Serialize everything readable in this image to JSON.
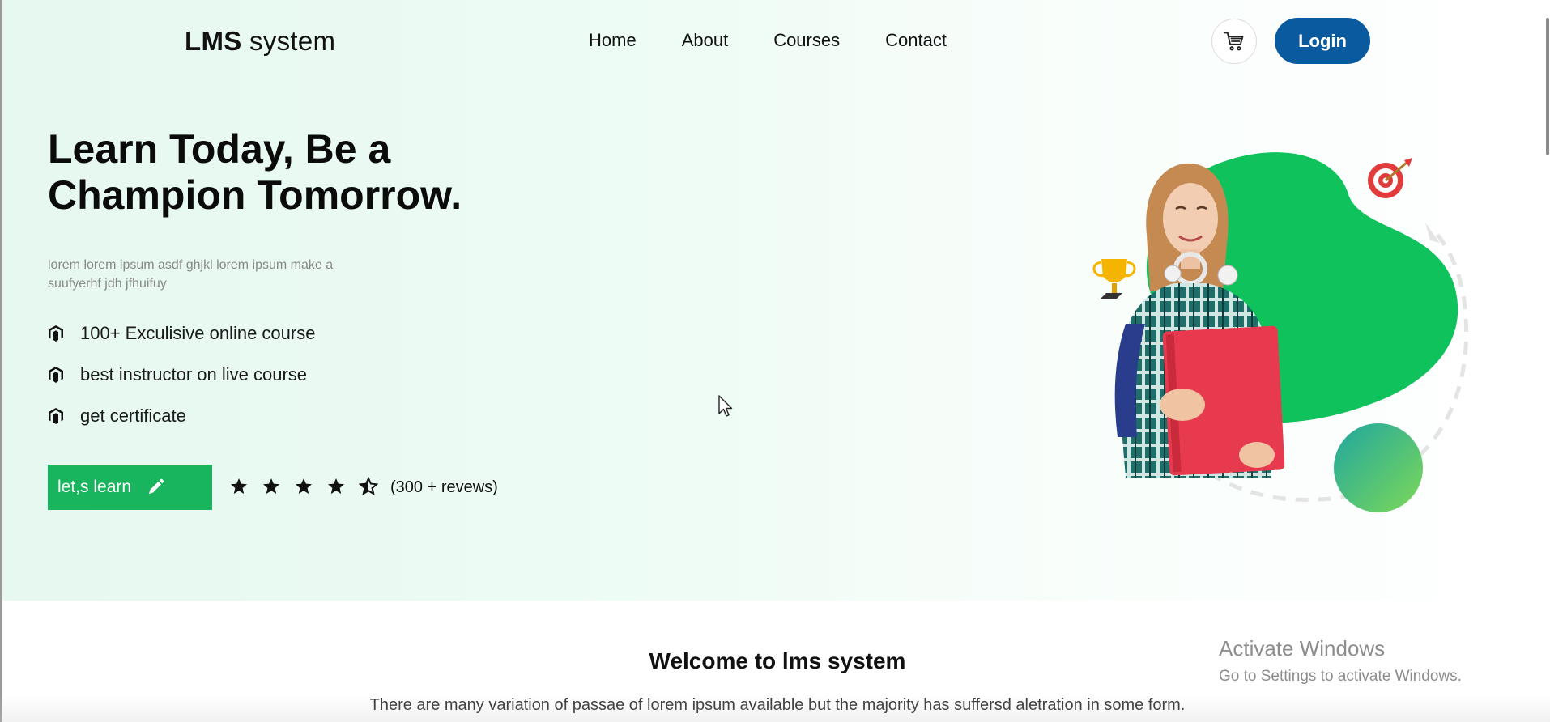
{
  "navbar": {
    "logo_bold": "LMS",
    "logo_light": "system",
    "links": [
      "Home",
      "About",
      "Courses",
      "Contact"
    ],
    "cart_icon": "cart-icon",
    "login_label": "Login"
  },
  "hero": {
    "title": "Learn Today, Be a Champion Tomorrow.",
    "description": "lorem lorem ipsum asdf ghjkl lorem ipsum make a suufyerhf jdh jfhuifuy",
    "features": [
      {
        "icon": "magento-icon",
        "text": "100+ Exculisive online course"
      },
      {
        "icon": "magento-icon",
        "text": "best instructor on live course"
      },
      {
        "icon": "magento-icon",
        "text": "get certificate"
      }
    ],
    "cta_label": "let,s learn",
    "cta_icon": "pen-icon",
    "rating": 4.5,
    "rating_max": 5,
    "reviews": "(300 + revews)"
  },
  "welcome": {
    "title": "Welcome to lms system",
    "text": "There are many variation of passae of lorem ipsum available but the majority has suffersd aletration in some form."
  },
  "watermark": {
    "line1": "Activate Windows",
    "line2": "Go to Settings to activate Windows."
  },
  "colors": {
    "accent_green": "#19b55e",
    "blob_green": "#0fc25b",
    "login_blue": "#0a5aa0"
  }
}
